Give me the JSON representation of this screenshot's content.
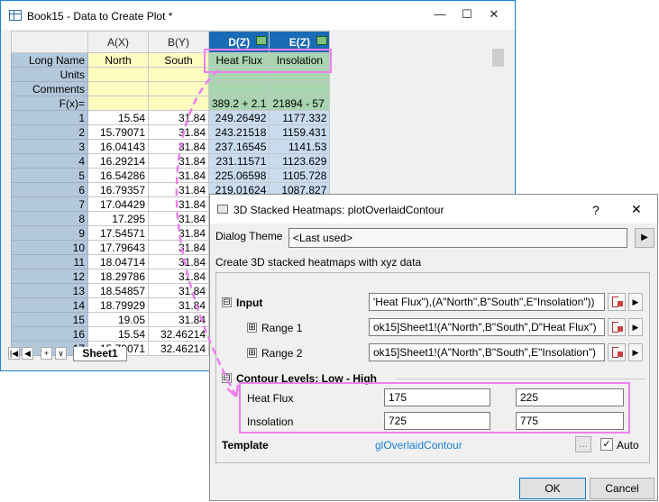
{
  "book": {
    "title": "Book15 - Data to Create Plot *",
    "min_glyph": "—",
    "max_glyph": "☐",
    "close_glyph": "✕"
  },
  "grid": {
    "columns": [
      {
        "header": "A(X)",
        "long_name": "North"
      },
      {
        "header": "B(Y)",
        "long_name": "South"
      },
      {
        "header": "D(Z)",
        "long_name": "Heat Flux"
      },
      {
        "header": "E(Z)",
        "long_name": "Insolation"
      }
    ],
    "row_labels": {
      "long_name": "Long Name",
      "units": "Units",
      "comments": "Comments",
      "fx": "F(x)="
    },
    "fx": {
      "d": "389.2 + 2.1",
      "e": "21894 - 57"
    },
    "rows": [
      {
        "n": "1",
        "a": "15.54",
        "b": "31.84",
        "d": "249.26492",
        "e": "1177.332"
      },
      {
        "n": "2",
        "a": "15.79071",
        "b": "31.84",
        "d": "243.21518",
        "e": "1159.431"
      },
      {
        "n": "3",
        "a": "16.04143",
        "b": "31.84",
        "d": "237.16545",
        "e": "1141.53"
      },
      {
        "n": "4",
        "a": "16.29214",
        "b": "31.84",
        "d": "231.11571",
        "e": "1123.629"
      },
      {
        "n": "5",
        "a": "16.54286",
        "b": "31.84",
        "d": "225.06598",
        "e": "1105.728"
      },
      {
        "n": "6",
        "a": "16.79357",
        "b": "31.84",
        "d": "219.01624",
        "e": "1087.827"
      },
      {
        "n": "7",
        "a": "17.04429",
        "b": "31.84",
        "d": "",
        "e": ""
      },
      {
        "n": "8",
        "a": "17.295",
        "b": "31.84",
        "d": "",
        "e": ""
      },
      {
        "n": "9",
        "a": "17.54571",
        "b": "31.84",
        "d": "",
        "e": ""
      },
      {
        "n": "10",
        "a": "17.79643",
        "b": "31.84",
        "d": "",
        "e": ""
      },
      {
        "n": "11",
        "a": "18.04714",
        "b": "31.84",
        "d": "",
        "e": ""
      },
      {
        "n": "12",
        "a": "18.29786",
        "b": "31.84",
        "d": "",
        "e": ""
      },
      {
        "n": "13",
        "a": "18.54857",
        "b": "31.84",
        "d": "",
        "e": ""
      },
      {
        "n": "14",
        "a": "18.79929",
        "b": "31.84",
        "d": "",
        "e": ""
      },
      {
        "n": "15",
        "a": "19.05",
        "b": "31.84",
        "d": "",
        "e": ""
      },
      {
        "n": "16",
        "a": "15.54",
        "b": "32.46214",
        "d": "",
        "e": ""
      },
      {
        "n": "17",
        "a": "15.79071",
        "b": "32.46214",
        "d": "",
        "e": ""
      }
    ]
  },
  "sheet_tabs": {
    "nav": [
      "|◀",
      "◀",
      "+",
      "∨"
    ],
    "active": "Sheet1"
  },
  "dialog": {
    "title": "3D Stacked Heatmaps: plotOverlaidContour",
    "help_glyph": "?",
    "close_glyph": "✕",
    "theme_label": "Dialog Theme",
    "theme_value": "<Last used>",
    "description": "Create 3D stacked heatmaps with xyz data",
    "input_label": "Input",
    "input_value": "'Heat Flux\"),(A\"North\",B\"South\",E\"Insolation\"))",
    "range1_label": "Range 1",
    "range1_value": "ok15]Sheet1!(A\"North\",B\"South\",D\"Heat Flux\")",
    "range2_label": "Range 2",
    "range2_value": "ok15]Sheet1!(A\"North\",B\"South\",E\"Insolation\")",
    "contour_label": "Contour Levels: Low - High",
    "levels": [
      {
        "name": "Heat Flux",
        "low": "175",
        "high": "225"
      },
      {
        "name": "Insolation",
        "low": "725",
        "high": "775"
      }
    ],
    "template_label": "Template",
    "template_value": "glOverlaidContour",
    "browse_label": "...",
    "auto_label": "Auto",
    "auto_checked": true,
    "ok_label": "OK",
    "cancel_label": "Cancel",
    "expand_glyph": "⊟",
    "add_glyph": "⊞",
    "check_glyph": "✓",
    "play_glyph": "▶"
  },
  "colors": {
    "callout": "#f07ef0",
    "selected_header": "#1a6bb5",
    "link": "#1a7ed4"
  }
}
